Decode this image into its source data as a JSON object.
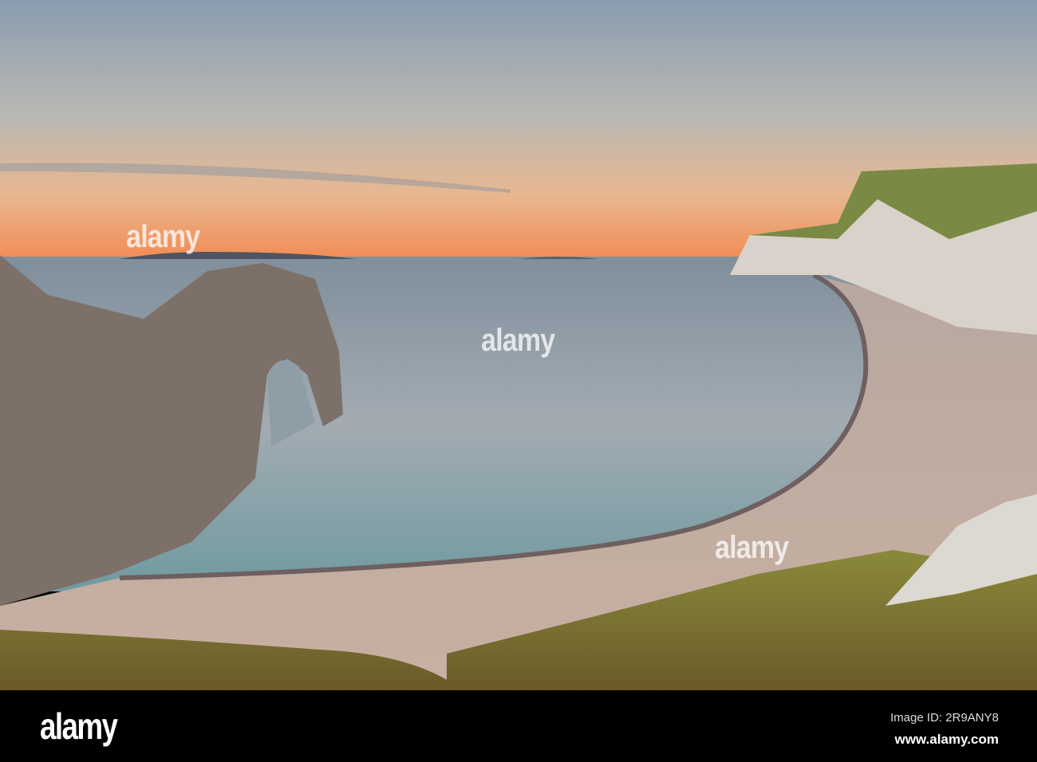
{
  "photo": {
    "watermark_text": "alamy"
  },
  "footer": {
    "logo": "alamy",
    "image_id": "Image ID: 2R9ANY8",
    "url": "www.alamy.com"
  }
}
